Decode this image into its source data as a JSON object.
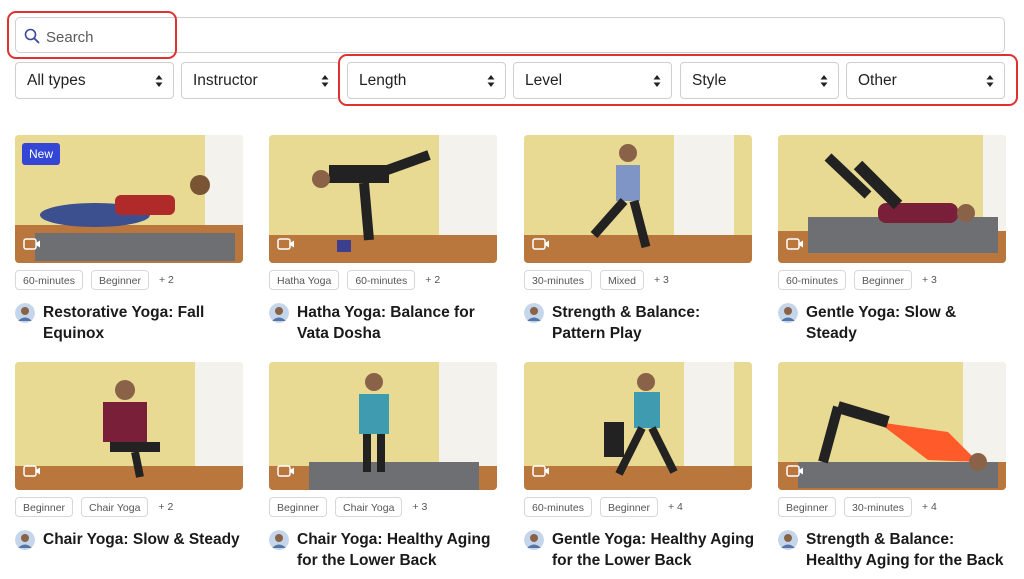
{
  "search": {
    "placeholder": "Search",
    "value": ""
  },
  "filters": [
    {
      "label": "All types"
    },
    {
      "label": "Instructor"
    },
    {
      "label": "Length"
    },
    {
      "label": "Level"
    },
    {
      "label": "Style"
    },
    {
      "label": "Other"
    }
  ],
  "colors": {
    "highlight": "#e03131",
    "new_badge": "#3346d6"
  },
  "cards": [
    {
      "title": "Restorative Yoga: Fall Equinox",
      "badge": "New",
      "tags": [
        "60-minutes",
        "Beginner",
        "+ 2"
      ]
    },
    {
      "title": "Hatha Yoga: Balance for Vata Dosha",
      "tags": [
        "Hatha Yoga",
        "60-minutes",
        "+ 2"
      ]
    },
    {
      "title": "Strength & Balance: Pattern Play",
      "tags": [
        "30-minutes",
        "Mixed",
        "+ 3"
      ]
    },
    {
      "title": "Gentle Yoga: Slow & Steady",
      "tags": [
        "60-minutes",
        "Beginner",
        "+ 3"
      ]
    },
    {
      "title": "Chair Yoga: Slow & Steady",
      "tags": [
        "Beginner",
        "Chair Yoga",
        "+ 2"
      ]
    },
    {
      "title": "Chair Yoga: Healthy Aging for the Lower Back",
      "tags": [
        "Beginner",
        "Chair Yoga",
        "+ 3"
      ]
    },
    {
      "title": "Gentle Yoga: Healthy Aging for the Lower Back",
      "tags": [
        "60-minutes",
        "Beginner",
        "+ 4"
      ]
    },
    {
      "title": "Strength & Balance: Healthy Aging for the Back",
      "tags": [
        "Beginner",
        "30-minutes",
        "+ 4"
      ]
    }
  ]
}
